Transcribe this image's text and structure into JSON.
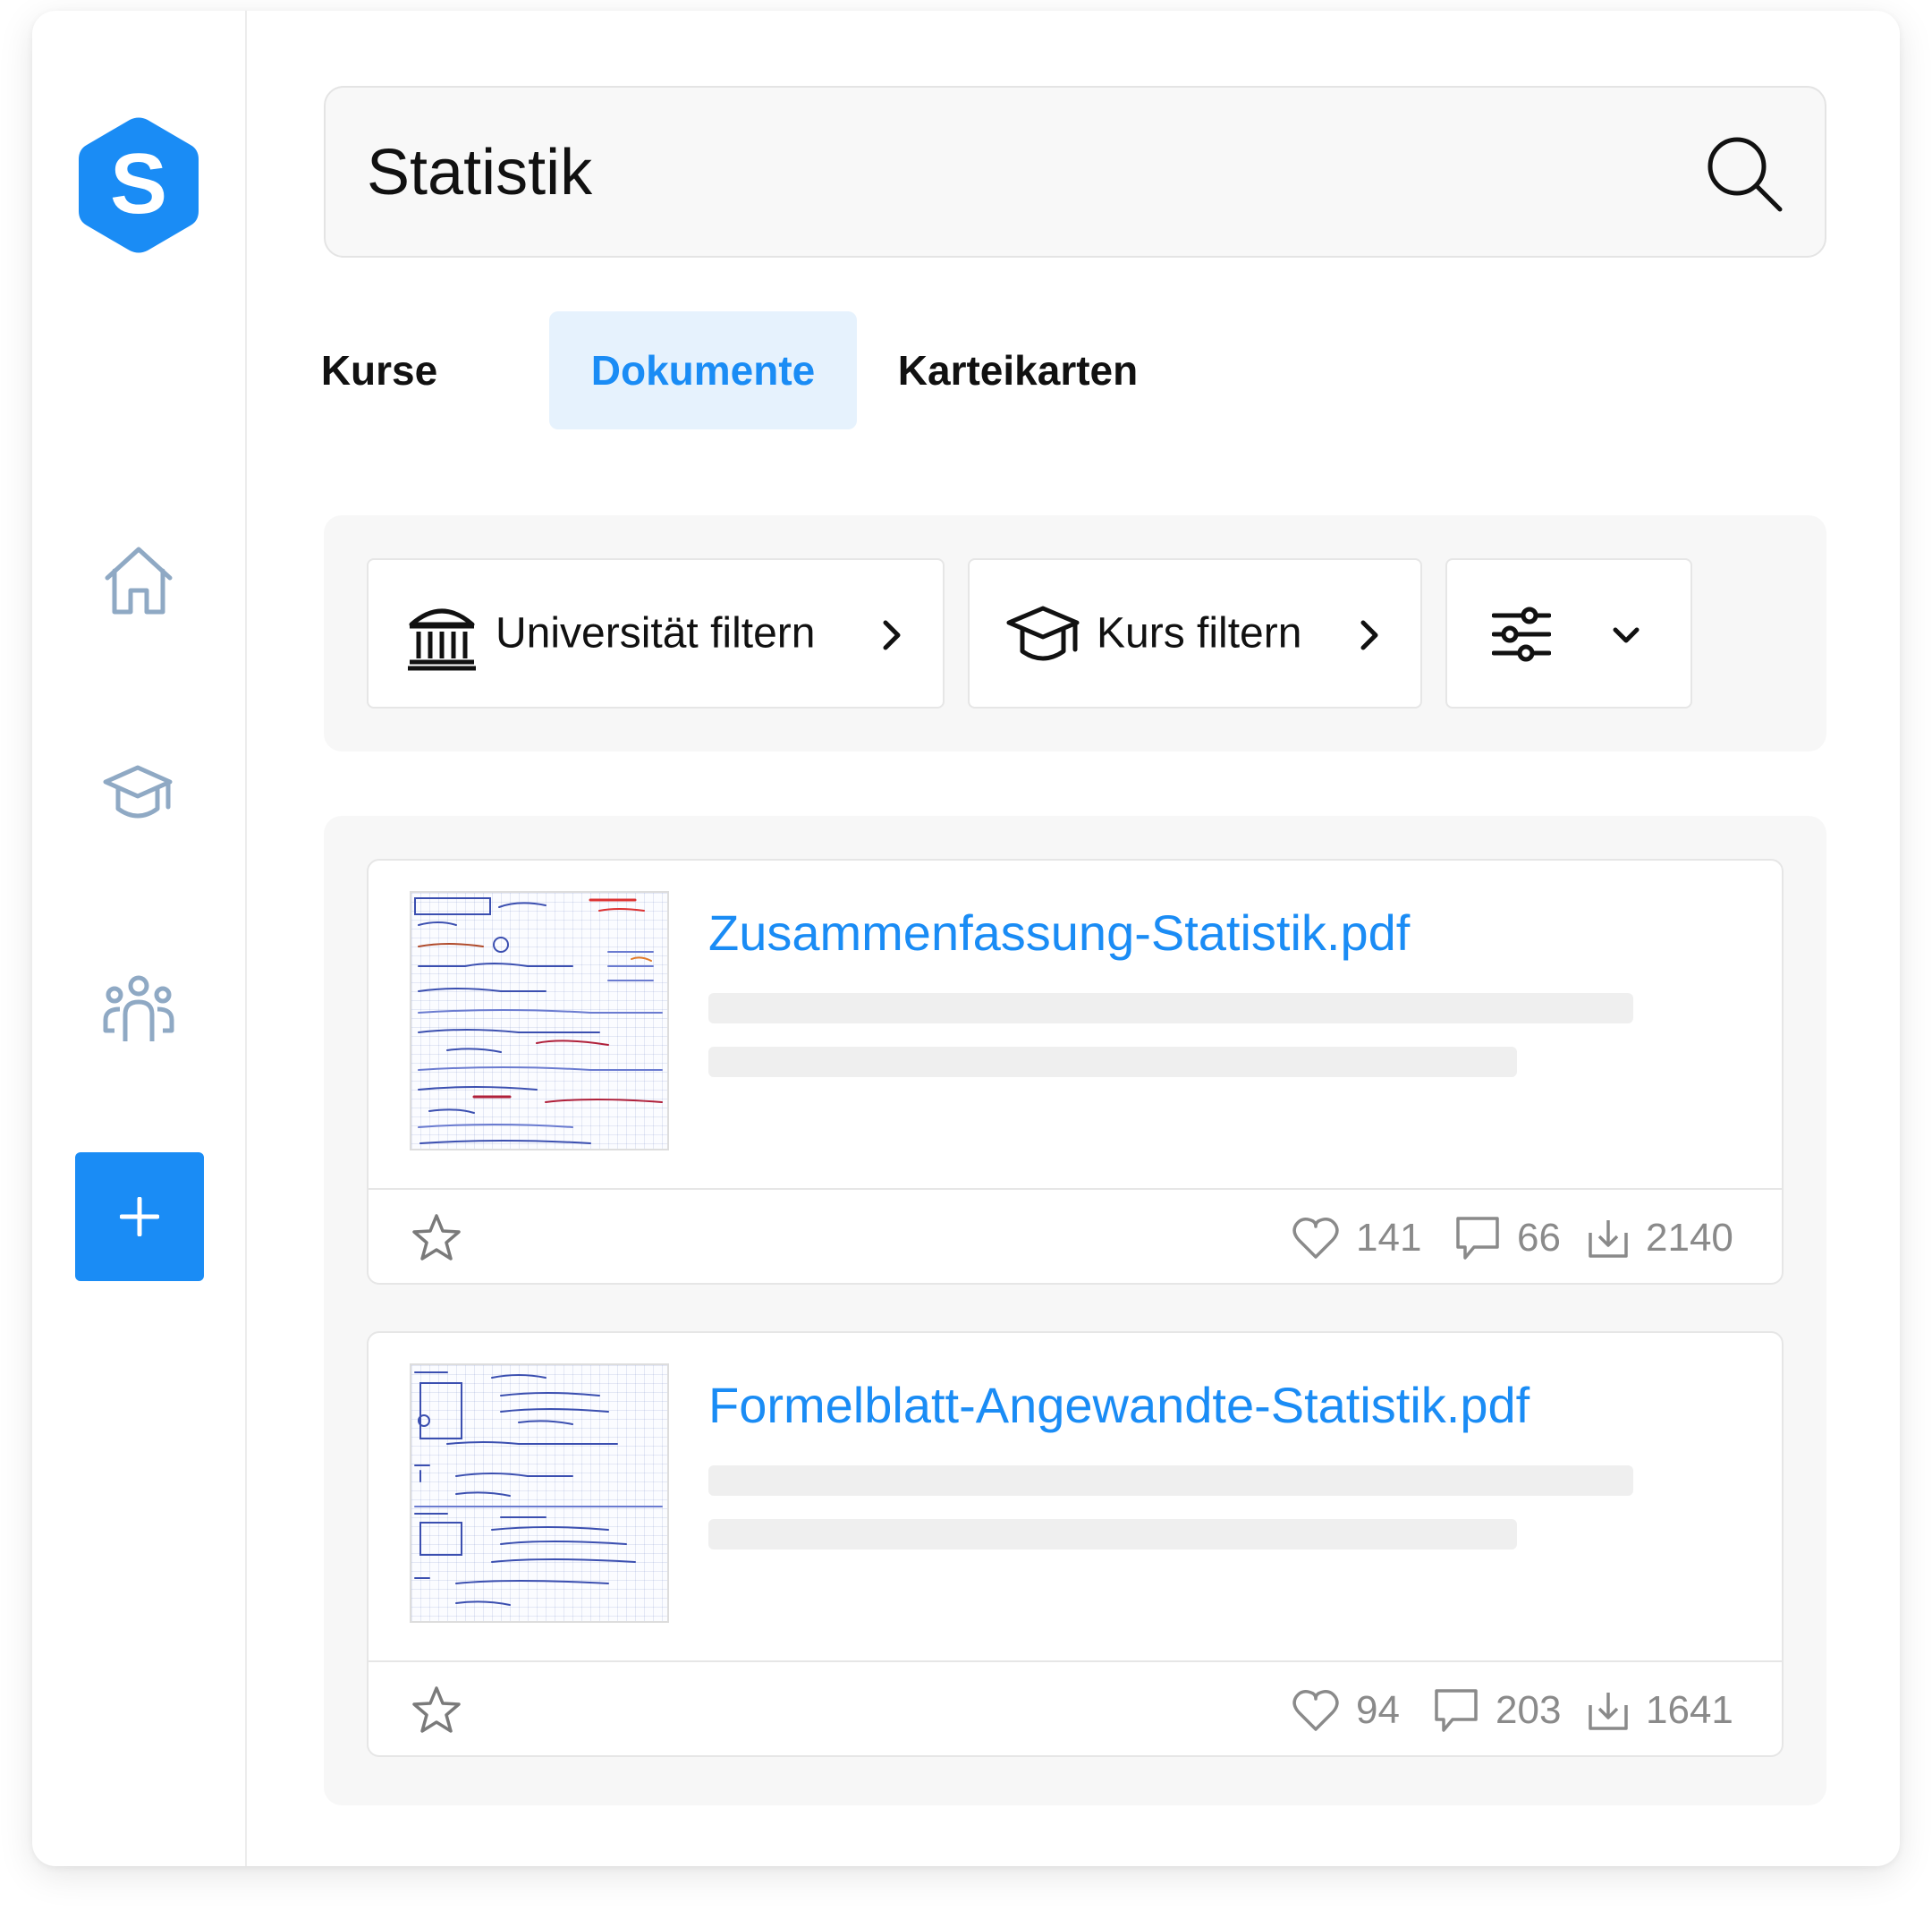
{
  "app": {
    "logo_letter": "S",
    "brand_color": "#1a8cf5",
    "nav_color": "#8fa9c4"
  },
  "sidebar": {
    "items": [
      {
        "icon": "home-icon"
      },
      {
        "icon": "graduation-cap-icon"
      },
      {
        "icon": "group-icon"
      }
    ],
    "add_icon": "plus-icon"
  },
  "search": {
    "value": "Statistik",
    "icon": "search-icon"
  },
  "tabs": [
    {
      "label": "Kurse",
      "active": false
    },
    {
      "label": "Dokumente",
      "active": true
    },
    {
      "label": "Karteikarten",
      "active": false
    }
  ],
  "filters": {
    "university": {
      "label": "Universität filtern",
      "icon": "university-icon"
    },
    "course": {
      "label": "Kurs filtern",
      "icon": "graduation-cap-icon"
    },
    "settings": {
      "icon": "sliders-icon",
      "dropdown_icon": "chevron-down-icon"
    }
  },
  "documents": [
    {
      "title": "Zusammenfassung-Statistik.pdf",
      "likes": "141",
      "comments": "66",
      "downloads": "2140"
    },
    {
      "title": "Formelblatt-Angewandte-Statistik.pdf",
      "likes": "94",
      "comments": "203",
      "downloads": "1641"
    }
  ]
}
